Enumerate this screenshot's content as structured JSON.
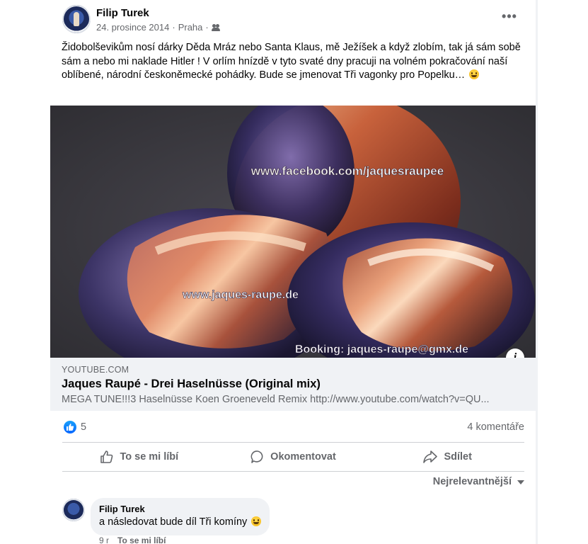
{
  "post": {
    "author": "Filip Turek",
    "date": "24. prosince 2014",
    "location": "Praha",
    "separator": "·",
    "audience_icon": "friends-icon",
    "more_label": "•••",
    "text": "Židobolševikům nosí dárky Děda Mráz nebo Santa Klaus, mě Ježíšek a když zlobím, tak já sám sobě sám a nebo mi naklade Hitler ! V orlím hnízdě v tyto svaté dny pracuji na volném pokračování naší oblíbené, národní českoněmecké pohádky. Bude se jmenovat Tři vagonky pro Popelku…"
  },
  "media": {
    "watermark_top": "www.facebook.com/jaquesraupee",
    "watermark_left": "www.jaques-raupe.de",
    "watermark_bottom": "Booking: jaques-raupe@gmx.de",
    "info_label": "i"
  },
  "link_preview": {
    "domain": "YOUTUBE.COM",
    "title": "Jaques Raupé - Drei Haselnüsse (Original mix)",
    "description": "MEGA TUNE!!!3 Haselnüsse Koen Groeneveld Remix http://www.youtube.com/watch?v=QU..."
  },
  "reactions": {
    "count": "5",
    "comments": "4 komentáře"
  },
  "actions": {
    "like": "To se mi líbí",
    "comment": "Okomentovat",
    "share": "Sdílet"
  },
  "sort": {
    "label": "Nejrelevantnější"
  },
  "comment": {
    "author": "Filip Turek",
    "text": "a následovat bude díl Tři komíny",
    "age": "9 r",
    "like": "To se mi líbí"
  },
  "colors": {
    "accent": "#0866ff",
    "secondary_text": "#65676b",
    "preview_bg": "#f0f2f5"
  }
}
